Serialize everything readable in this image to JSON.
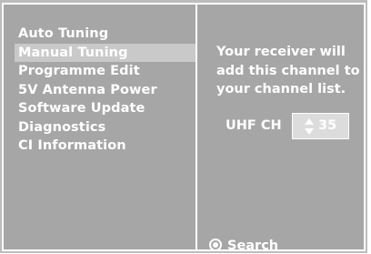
{
  "menu": {
    "items": [
      {
        "label": "Auto Tuning",
        "selected": false
      },
      {
        "label": "Manual Tuning",
        "selected": true
      },
      {
        "label": "Programme Edit",
        "selected": false
      },
      {
        "label": "5V Antenna Power",
        "selected": false
      },
      {
        "label": "Software Update",
        "selected": false
      },
      {
        "label": "Diagnostics",
        "selected": false
      },
      {
        "label": "CI Information",
        "selected": false
      }
    ]
  },
  "manual_tuning": {
    "message_lines": [
      "Your receiver will",
      "add this channel to",
      "your channel list."
    ],
    "channel_label": "UHF CH",
    "channel_value": "35"
  },
  "footer": {
    "search_label": "Search",
    "search_icon": "select-circle-icon"
  },
  "colors": {
    "background": "#a6a6a6",
    "text": "#ffffff",
    "selected_row": "#c9c9c9",
    "stepper_bg": "#dcdcdc"
  }
}
